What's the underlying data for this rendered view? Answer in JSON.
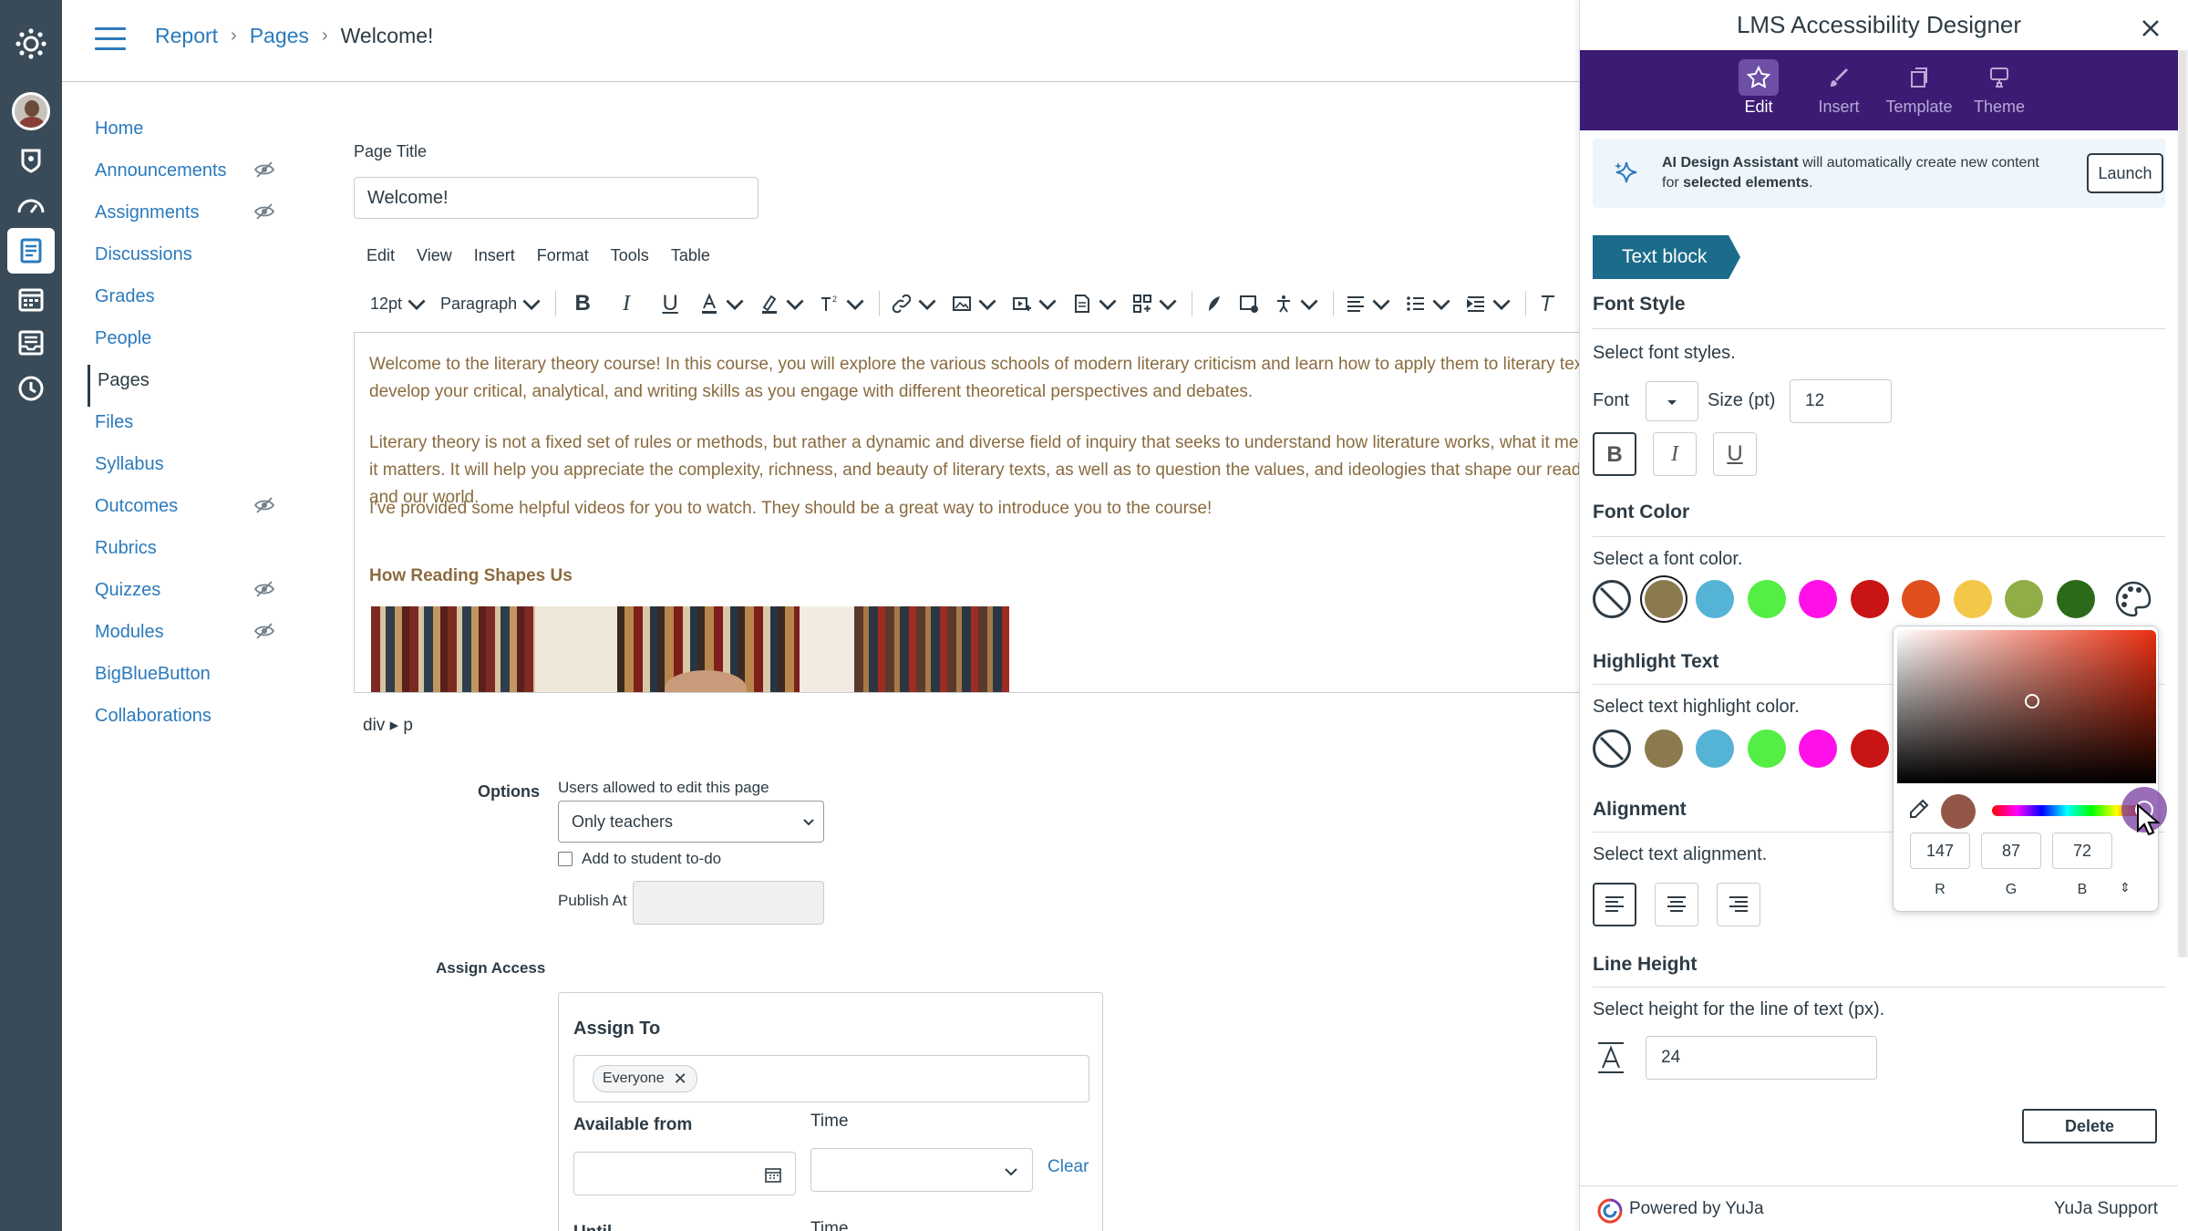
{
  "breadcrumb": [
    "Report",
    "Pages",
    "Welcome!"
  ],
  "course_nav": [
    {
      "label": "Home",
      "hidden": false
    },
    {
      "label": "Announcements",
      "hidden": true
    },
    {
      "label": "Assignments",
      "hidden": true
    },
    {
      "label": "Discussions",
      "hidden": false
    },
    {
      "label": "Grades",
      "hidden": false
    },
    {
      "label": "People",
      "hidden": false
    },
    {
      "label": "Pages",
      "hidden": false,
      "active": true
    },
    {
      "label": "Files",
      "hidden": false
    },
    {
      "label": "Syllabus",
      "hidden": false
    },
    {
      "label": "Outcomes",
      "hidden": true
    },
    {
      "label": "Rubrics",
      "hidden": false
    },
    {
      "label": "Quizzes",
      "hidden": true
    },
    {
      "label": "Modules",
      "hidden": true
    },
    {
      "label": "BigBlueButton",
      "hidden": false
    },
    {
      "label": "Collaborations",
      "hidden": false
    }
  ],
  "editor": {
    "page_title_label": "Page Title",
    "page_title_value": "Welcome!",
    "menu": [
      "Edit",
      "View",
      "Insert",
      "Format",
      "Tools",
      "Table"
    ],
    "font_size": "12pt",
    "block_format": "Paragraph",
    "paragraphs": [
      "Welcome to the literary theory course! In this course, you will explore the various schools of modern literary criticism and learn how to apply them to literary texts. You will develop your critical, analytical, and writing skills as you engage with different theoretical perspectives and debates.",
      "Literary theory is not a fixed set of rules or methods, but rather a dynamic and diverse field of inquiry that seeks to understand how literature works, what it means, and why it matters. It will help you appreciate the complexity, richness, and beauty of literary texts, as well as to question the values, and ideologies that shape our reading practices and our world.",
      "I've provided some helpful videos for you to watch. They should be a great way to introduce you to the course!"
    ],
    "heading": "How Reading Shapes Us",
    "path": "div ▸ p",
    "text_color": "#8a6b3f"
  },
  "options": {
    "label": "Options",
    "edit_label": "Users allowed to edit this page",
    "edit_value": "Only teachers",
    "todo_label": "Add to student to-do",
    "publish_label": "Publish At"
  },
  "assign": {
    "section_label": "Assign Access",
    "assign_to": "Assign To",
    "chip": "Everyone",
    "available_from": "Available from",
    "time": "Time",
    "clear": "Clear",
    "until": "Until",
    "time2": "Time"
  },
  "panel": {
    "title": "LMS Accessibility Designer",
    "tabs": [
      {
        "label": "Edit",
        "active": true,
        "icon": "star-icon"
      },
      {
        "label": "Insert",
        "active": false,
        "icon": "brush-icon"
      },
      {
        "label": "Template",
        "active": false,
        "icon": "template-icon"
      },
      {
        "label": "Theme",
        "active": false,
        "icon": "theme-icon"
      }
    ],
    "ai_banner": {
      "strong1": "AI Design Assistant",
      "text1": " will automatically create new content for ",
      "strong2": "selected elements",
      "text2": ".",
      "button": "Launch"
    },
    "block_tag": "Text block",
    "font_style": {
      "title": "Font Style",
      "desc": "Select font styles.",
      "font_label": "Font",
      "size_label": "Size (pt)",
      "size_value": "12",
      "bold": "B",
      "italic": "I",
      "underline": "U"
    },
    "font_color": {
      "title": "Font Color",
      "desc": "Select a font color.",
      "swatches": [
        "none",
        "#8a7a4e",
        "#55b3d6",
        "#55ee44",
        "#ff10e8",
        "#c81414",
        "#e0501e",
        "#f3c74a",
        "#8fae48",
        "#2a6a18"
      ],
      "selected_index": 1
    },
    "highlight": {
      "title": "Highlight Text",
      "desc": "Select text highlight color.",
      "swatches": [
        "none",
        "#8a7a4e",
        "#55b3d6",
        "#55ee44",
        "#ff10e8",
        "#c81414"
      ]
    },
    "picker": {
      "r": "147",
      "g": "87",
      "b": "72",
      "r_label": "R",
      "g_label": "G",
      "b_label": "B",
      "toggle": "⇕",
      "color": "#935748"
    },
    "alignment": {
      "title": "Alignment",
      "desc": "Select text alignment."
    },
    "line_height": {
      "title": "Line Height",
      "desc": "Select height for the line of text (px).",
      "value": "24"
    },
    "delete": "Delete",
    "footer_left": "Powered by YuJa",
    "footer_right": "YuJa Support"
  }
}
